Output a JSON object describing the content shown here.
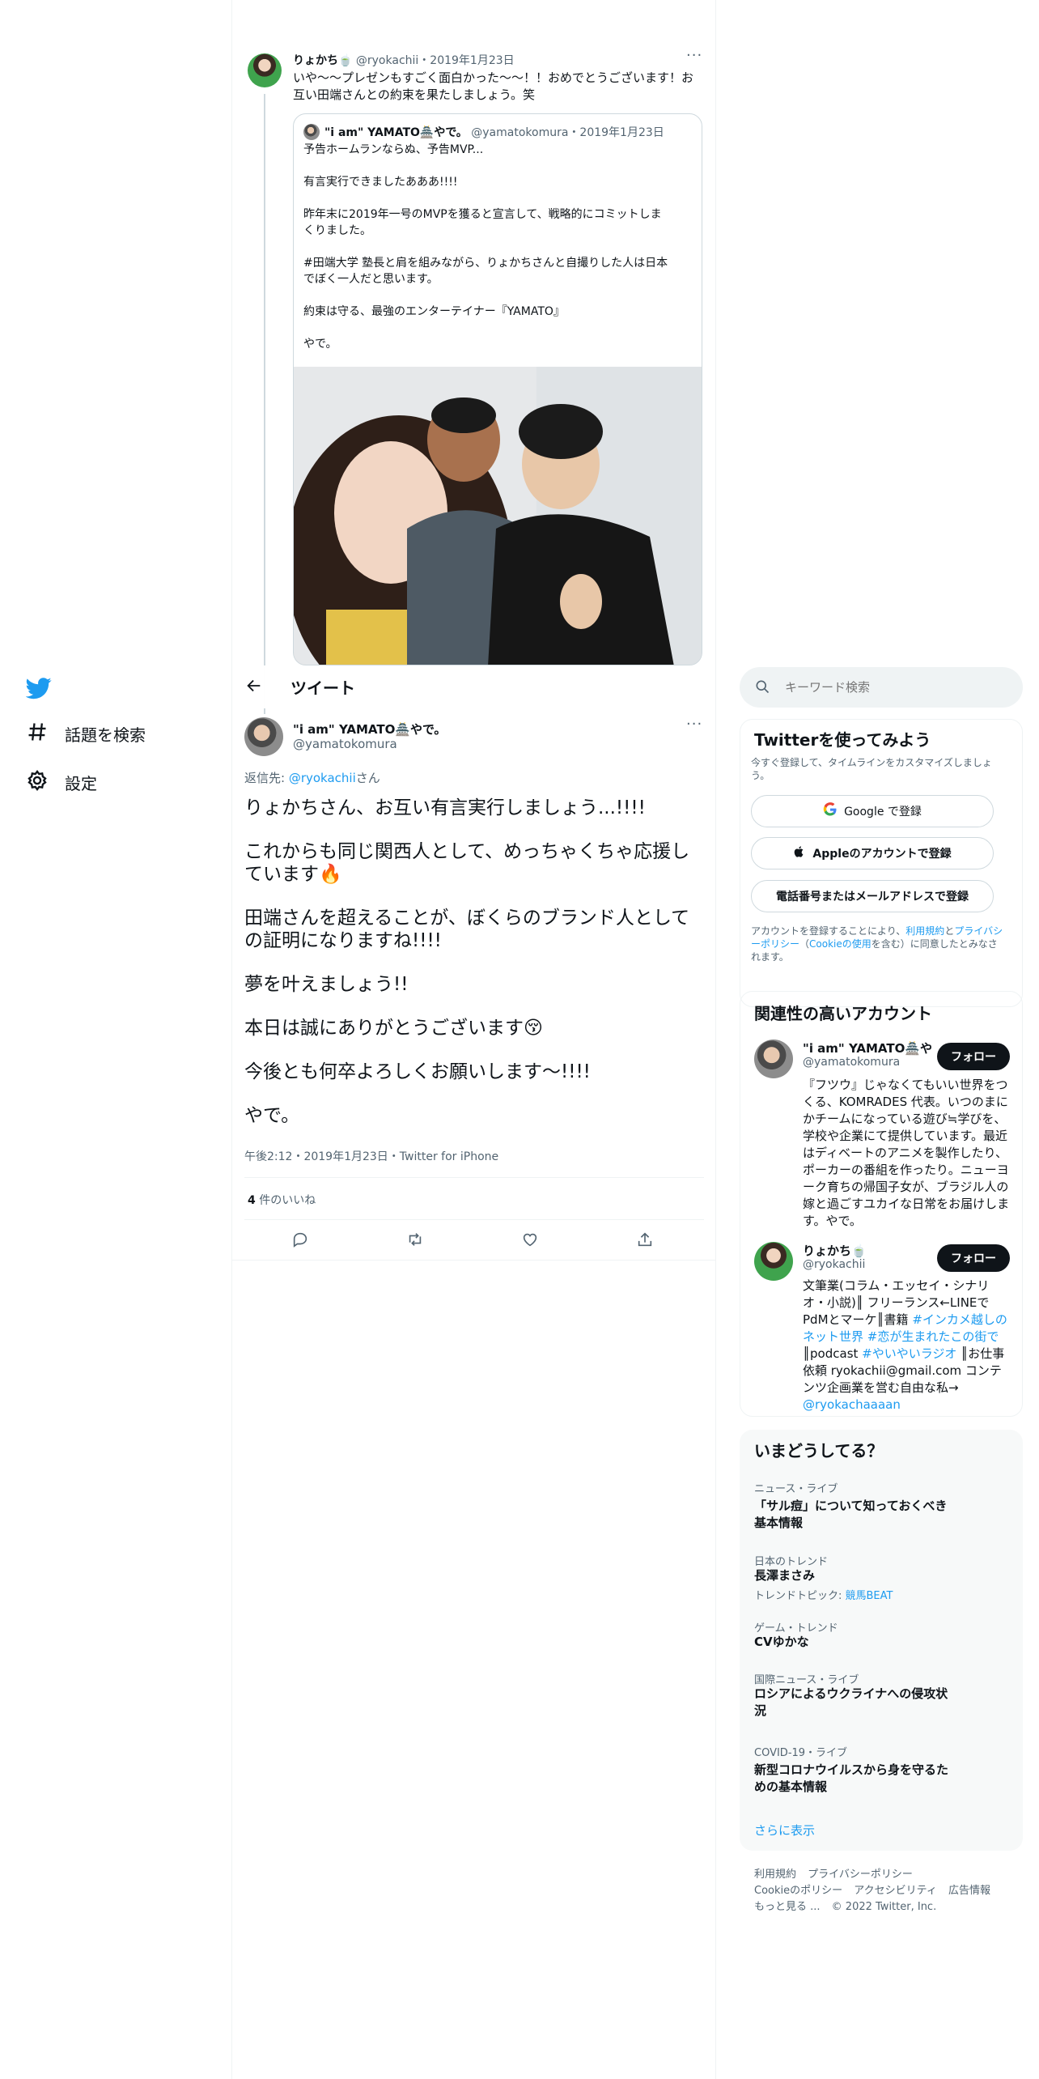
{
  "nav": {
    "explore": "話題を検索",
    "settings": "設定"
  },
  "quoted_context": {
    "author_name": "りょかち🍵",
    "author_handle": "@ryokachii",
    "date": "・2019年1月23日",
    "text_line1": "いや〜〜プレゼンもすごく面白かった〜〜！！おめでとうございます！お",
    "text_line2": "互い田端さんとの約束を果たしましょう。笑",
    "embed": {
      "author_name": "\"i am\" YAMATO🏯やで。",
      "author_handle": "@yamatokomura",
      "date": "・2019年1月23日",
      "lines": [
        "予告ホームランならぬ、予告MVP...",
        "有言実行できましたあああ!!!!",
        "昨年末に2019年一号のMVPを獲ると宣言して、戦略的にコミットしま",
        "くりました。",
        "#田端大学 塾長と肩を組みながら、りょかちさんと自撮りした人は日本",
        "でぼく一人だと思います。",
        "約束は守る、最強のエンターテイナー『YAMATO』",
        "やで。"
      ]
    }
  },
  "header": {
    "title": "ツイート"
  },
  "tweet": {
    "author_name": "\"i am\" YAMATO🏯やで。",
    "author_handle": "@yamatokomura",
    "reply_prefix": "返信先: ",
    "reply_to": "@ryokachii",
    "reply_suffix": "さん",
    "paragraphs": [
      "りょかちさん、お互い有言実行しましょう...!!!!",
      "これからも同じ関西人として、めっちゃくちゃ応援しています🔥",
      "田端さんを超えることが、ぼくらのブランド人としての証明になりますね!!!!",
      "夢を叶えましょう!!",
      "本日は誠にありがとうございます😚",
      "今後とも何卒よろしくお願いします〜!!!!",
      "やで。"
    ],
    "meta": "午後2:12・2019年1月23日・Twitter for iPhone",
    "likes_count": "4",
    "likes_label": " 件のいいね"
  },
  "search": {
    "placeholder": "キーワード検索"
  },
  "signup": {
    "title": "Twitterを使ってみよう",
    "subtitle": "今すぐ登録して、タイムラインをカスタマイズしましょう。",
    "google": "Google で登録",
    "apple": "Appleのアカウントで登録",
    "phone": "電話番号またはメールアドレスで登録",
    "terms_pre": "アカウントを登録することにより、",
    "terms_link1": "利用規約",
    "terms_mid1": "と",
    "terms_link2": "プライバシーポリシー",
    "terms_mid2": "（",
    "terms_link3": "Cookieの使用",
    "terms_post": "を含む）に同意したとみなされます。"
  },
  "related": {
    "title": "関連性の高いアカウント",
    "follow_label": "フォロー",
    "accounts": [
      {
        "name": "\"i am\" YAMATO🏯や...",
        "handle": "@yamatokomura",
        "bio": "『フツウ』じゃなくてもいい世界をつくる、KOMRADES 代表。いつのまにかチームになっている遊び≒学びを、学校や企業にて提供しています。最近はディベートのアニメを製作したり、ポーカーの番組を作ったり。ニューヨーク育ちの帰国子女が、ブラジル人の嫁と過ごすユカイな日常をお届けします。やで。"
      },
      {
        "name": "りょかち🍵",
        "handle": "@ryokachii",
        "bio_a": "文筆業(コラム・エッセイ・シナリオ・小説)║ フリーランス←LINEでPdMとマーケ║書籍 ",
        "bio_link1": "#インカメ越しのネット世界",
        "bio_b": " ",
        "bio_link2": "#恋が生まれたこの街で",
        "bio_c": "║podcast ",
        "bio_link3": "#やいやいラジオ",
        "bio_d": " ║お仕事依頼 ryokachii@gmail.com コンテンツ企画業を営む自由な私→ ",
        "bio_link4": "@ryokachaaaan"
      }
    ]
  },
  "trends": {
    "title": "いまどうしてる？",
    "items": [
      {
        "category": "ニュース・ライブ",
        "title": "「サル痘」について知っておくべき基本情報"
      },
      {
        "category": "日本のトレンド",
        "title": "長澤まさみ",
        "topic_label": "トレンドトピック: ",
        "topic": "競馬BEAT"
      },
      {
        "category": "ゲーム・トレンド",
        "title": "CVゆかな"
      },
      {
        "category": "国際ニュース・ライブ",
        "title": "ロシアによるウクライナへの侵攻状況"
      },
      {
        "category": "COVID-19・ライブ",
        "title": "新型コロナウイルスから身を守るための基本情報"
      }
    ],
    "more": "さらに表示"
  },
  "footer": {
    "line1": [
      "利用規約",
      "プライバシーポリシー"
    ],
    "line2": [
      "Cookieのポリシー",
      "アクセシビリティ",
      "広告情報"
    ],
    "more": "もっと見る ...",
    "copyright": "© 2022 Twitter, Inc."
  }
}
